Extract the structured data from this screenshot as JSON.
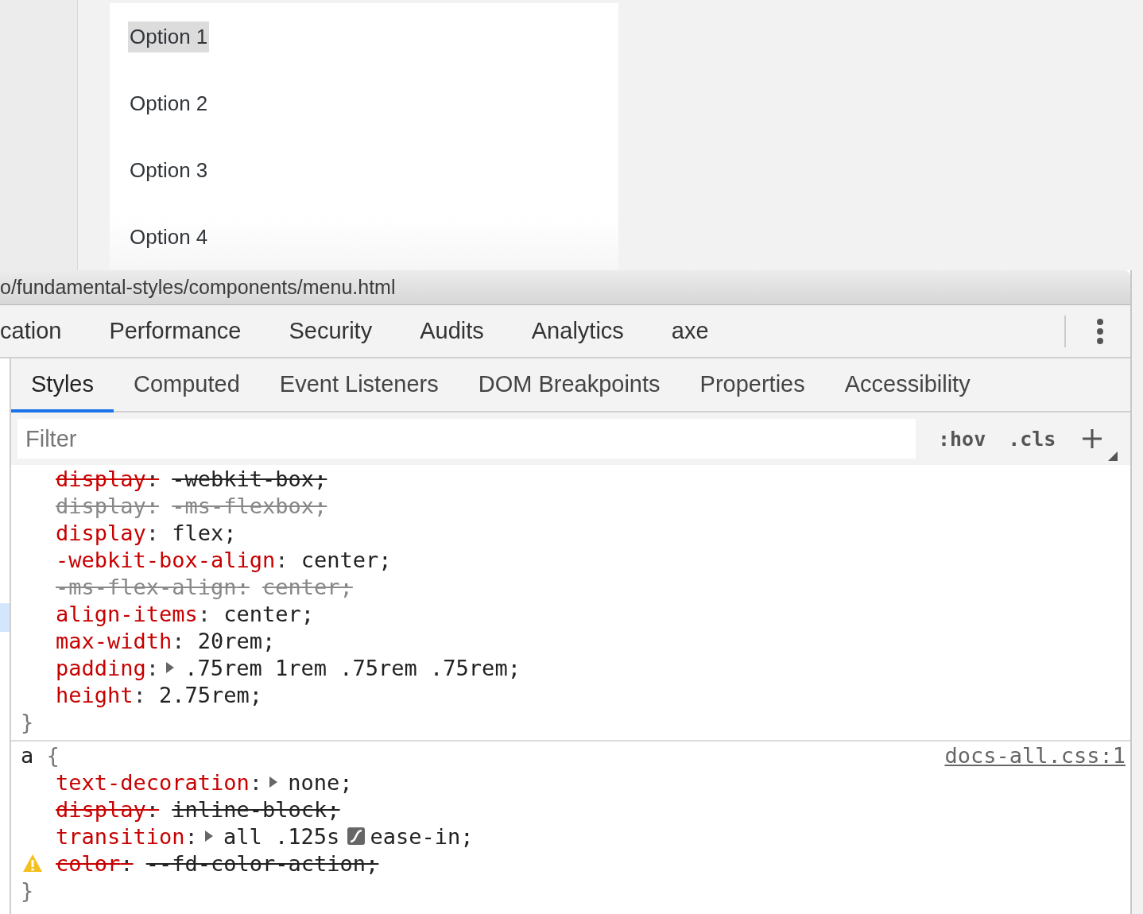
{
  "menu": {
    "options": [
      {
        "label": "Option 1",
        "selected": true
      },
      {
        "label": "Option 2",
        "selected": false
      },
      {
        "label": "Option 3",
        "selected": false
      },
      {
        "label": "Option 4",
        "selected": false
      }
    ]
  },
  "devtools": {
    "url": "o/fundamental-styles/components/menu.html",
    "main_tabs": [
      {
        "label": "cation",
        "selected": false
      },
      {
        "label": "Performance",
        "selected": false
      },
      {
        "label": "Security",
        "selected": false
      },
      {
        "label": "Audits",
        "selected": false
      },
      {
        "label": "Analytics",
        "selected": false
      },
      {
        "label": "axe",
        "selected": false
      }
    ],
    "sub_tabs": [
      {
        "label": "Styles",
        "selected": true
      },
      {
        "label": "Computed",
        "selected": false
      },
      {
        "label": "Event Listeners",
        "selected": false
      },
      {
        "label": "DOM Breakpoints",
        "selected": false
      },
      {
        "label": "Properties",
        "selected": false
      },
      {
        "label": "Accessibility",
        "selected": false
      }
    ],
    "filter": {
      "placeholder": "Filter"
    },
    "toolbar_buttons": [
      ":hov",
      ".cls"
    ],
    "rules": [
      {
        "declarations": [
          {
            "kind": "overridden",
            "name": "display",
            "separator": ":",
            "value": "-webkit-box;"
          },
          {
            "kind": "unsupported",
            "name": "display",
            "separator": ":",
            "value": "-ms-flexbox;"
          },
          {
            "kind": "active",
            "name": "display",
            "separator": ":",
            "value": "flex;"
          },
          {
            "kind": "active",
            "name": "-webkit-box-align",
            "separator": ":",
            "value": "center;"
          },
          {
            "kind": "unsupported",
            "name": "-ms-flex-align",
            "separator": ":",
            "value": "center;"
          },
          {
            "kind": "active",
            "name": "align-items",
            "separator": ":",
            "value": "center;"
          },
          {
            "kind": "active",
            "name": "max-width",
            "separator": ":",
            "value": "20rem;"
          },
          {
            "kind": "active",
            "name": "padding",
            "separator": ":",
            "expandable": true,
            "value": ".75rem 1rem .75rem .75rem;"
          },
          {
            "kind": "active",
            "name": "height",
            "separator": ":",
            "value": "2.75rem;"
          }
        ],
        "close": "}"
      },
      {
        "selector": "a",
        "open": "{",
        "source": "docs-all.css:1",
        "declarations": [
          {
            "kind": "active",
            "name": "text-decoration",
            "separator": ":",
            "expandable": true,
            "value": "none;"
          },
          {
            "kind": "overridden",
            "name": "display",
            "separator": ":",
            "value": "inline-block;"
          },
          {
            "kind": "active",
            "name": "transition",
            "separator": ":",
            "expandable": true,
            "value": "all .125s",
            "after_swatch": "ease-in;"
          },
          {
            "kind": "overridden",
            "name": "color",
            "separator": ":",
            "value": "--fd-color-action;",
            "warning": true
          }
        ],
        "close": "}"
      }
    ]
  }
}
